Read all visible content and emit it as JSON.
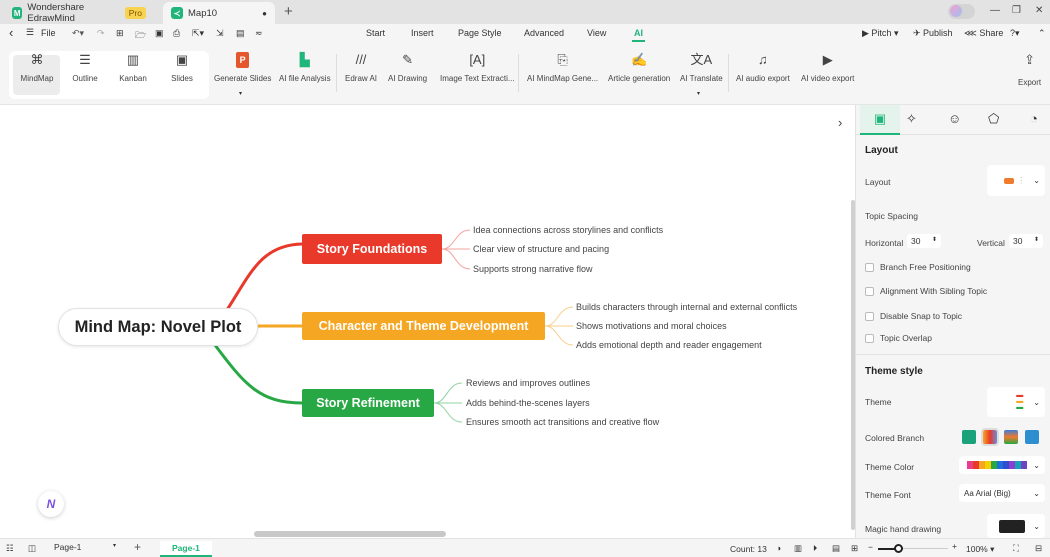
{
  "titlebar": {
    "app_tab": "Wondershare EdrawMind",
    "pro_badge": "Pro",
    "doc_tab": "Map10",
    "new_tab": "+",
    "win": [
      "—",
      "❐",
      "✕"
    ]
  },
  "menubar": {
    "back": "‹",
    "file": "File",
    "tabs": [
      "Start",
      "Insert",
      "Page Style",
      "Advanced",
      "View",
      "AI"
    ],
    "active_tab": "AI",
    "right": [
      "Pitch",
      "Publish",
      "Share"
    ]
  },
  "ribbon": {
    "views": [
      {
        "label": "MindMap",
        "icon": "⌘"
      },
      {
        "label": "Outline",
        "icon": "☰"
      },
      {
        "label": "Kanban",
        "icon": "▥"
      },
      {
        "label": "Slides",
        "icon": "▣"
      }
    ],
    "tools": [
      {
        "label": "Generate Slides",
        "icon": "P"
      },
      {
        "label": "AI file Analysis",
        "icon": "▙"
      },
      {
        "label": "Edraw AI",
        "icon": "///"
      },
      {
        "label": "AI Drawing",
        "icon": "✎"
      },
      {
        "label": "Image Text Extracti...",
        "icon": "[A]"
      },
      {
        "label": "AI MindMap Gene...",
        "icon": "⎘"
      },
      {
        "label": "Article generation",
        "icon": "✍"
      },
      {
        "label": "AI Translate",
        "icon": "文A"
      },
      {
        "label": "AI audio export",
        "icon": "♫"
      },
      {
        "label": "AI video export",
        "icon": "▶"
      },
      {
        "label": "Export",
        "icon": "⇪"
      }
    ]
  },
  "mindmap": {
    "central": "Mind Map: Novel Plot",
    "branches": [
      {
        "label": "Story Foundations",
        "color": "#e8392b",
        "subs": [
          "Idea connections across storylines and conflicts",
          "Clear view of structure and pacing",
          "Supports strong narrative flow"
        ]
      },
      {
        "label": "Character and Theme Development",
        "color": "#f5a623",
        "subs": [
          "Builds characters through internal and external conflicts",
          "Shows motivations and moral choices",
          "Adds emotional depth and reader engagement"
        ]
      },
      {
        "label": "Story Refinement",
        "color": "#27a844",
        "subs": [
          "Reviews and improves outlines",
          "Adds behind-the-scenes layers",
          "Ensures smooth act transitions and creative flow"
        ]
      }
    ]
  },
  "panel": {
    "layout_heading": "Layout",
    "layout_label": "Layout",
    "topic_spacing": "Topic Spacing",
    "horizontal_label": "Horizontal",
    "horizontal_value": "30",
    "vertical_label": "Vertical",
    "vertical_value": "30",
    "checkboxes": [
      "Branch Free Positioning",
      "Alignment With Sibling Topic",
      "Disable Snap to Topic",
      "Topic Overlap"
    ],
    "theme_heading": "Theme style",
    "theme_label": "Theme",
    "colored_branch_label": "Colored Branch",
    "theme_color_label": "Theme Color",
    "theme_font_label": "Theme Font",
    "theme_font_value": "Aa Arial (Big)",
    "magic_label": "Magic hand drawing",
    "theme_colors": [
      "#e83e8c",
      "#e8392b",
      "#f5a623",
      "#f5d000",
      "#27a844",
      "#1e6fd9",
      "#2f4fd0",
      "#8a3fd1",
      "#17a2b8",
      "#6f42c1"
    ],
    "accent": "#1fb57b"
  },
  "statusbar": {
    "page_select": "Page-1",
    "page_tab": "Page-1",
    "count": "Count: 13",
    "zoom": "100%"
  }
}
